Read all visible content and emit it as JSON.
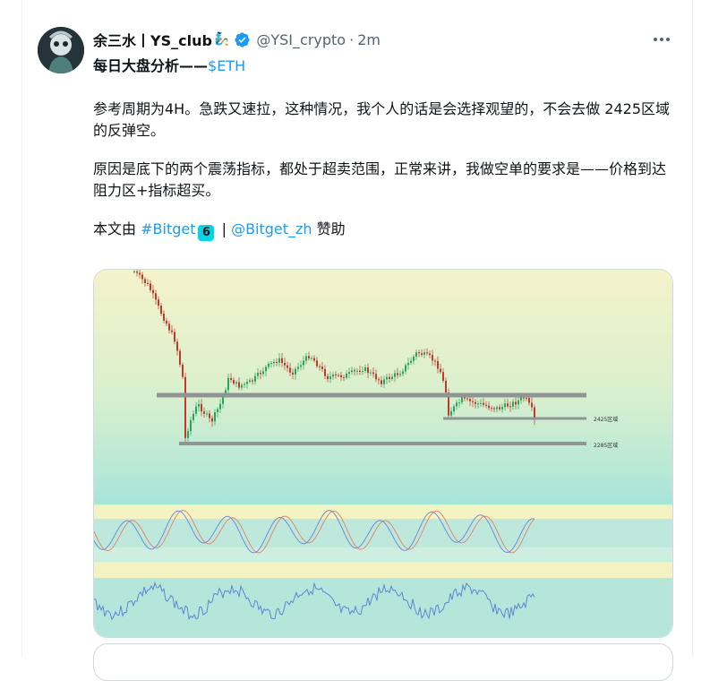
{
  "tweet": {
    "author_name": "余三水丨YS_club",
    "author_emoji": "🧞",
    "handle": "@YSI_crypto",
    "separator": "·",
    "time": "2m",
    "title_text": "每日大盘分析——",
    "cashtag": "$ETH",
    "paragraph1": "参考周期为4H。急跌又速拉，这种情况，我个人的话是会选择观望的，不会去做 2425区域的反弹空。",
    "paragraph2": "原因是底下的两个震荡指标，都处于超卖范围，正常来讲，我做空单的要求是——价格到达阻力区+指标超买。",
    "sponsor_prefix": "本文由",
    "hashtag": "#Bitget",
    "sponsor_sep": "|",
    "mention": "@Bitget_zh",
    "sponsor_suffix": "赞助",
    "bitget_badge": "6"
  },
  "chart": {
    "label_2425": "2425区域",
    "label_2285": "2285区域"
  },
  "icons": {
    "verified": "verified-badge-icon",
    "more": "more-icon",
    "avatar": "avatar-image"
  },
  "colors": {
    "link": "#1d9bf0",
    "up_candle": "#26a65b",
    "down_candle": "#c0392b",
    "level_line": "#8f9593"
  }
}
